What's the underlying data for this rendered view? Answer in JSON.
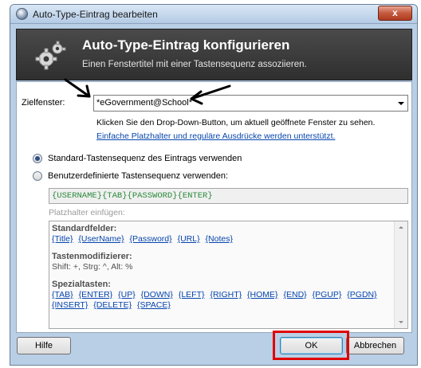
{
  "window": {
    "title": "Auto-Type-Eintrag bearbeiten",
    "close_label": "x"
  },
  "banner": {
    "title": "Auto-Type-Eintrag konfigurieren",
    "subtitle": "Einen Fenstertitel mit einer Tastensequenz assoziieren."
  },
  "target_window": {
    "label": "Zielfenster:",
    "value": "*eGovernment@School*"
  },
  "hint": "Klicken Sie den Drop-Down-Button, um aktuell geöffnete Fenster zu sehen.",
  "placeholder_link": "Einfache Platzhalter und reguläre Ausdrücke werden unterstützt.",
  "options": {
    "default_sequence": "Standard-Tastensequenz des Eintrags verwenden",
    "custom_sequence": "Benutzerdefinierte Tastensequenz verwenden:",
    "selected": "default_sequence"
  },
  "sequence": "{USERNAME}{TAB}{PASSWORD}{ENTER}",
  "placeholders": {
    "label": "Platzhalter einfügen:",
    "sections": [
      {
        "heading": "Standardfelder:",
        "links": [
          "{Title}",
          "{UserName}",
          "{Password}",
          "{URL}",
          "{Notes}"
        ]
      },
      {
        "heading": "Tastenmodifizierer:",
        "text": "Shift: +, Strg: ^, Alt: %"
      },
      {
        "heading": "Spezialtasten:",
        "links": [
          "{TAB}",
          "{ENTER}",
          "{UP}",
          "{DOWN}",
          "{LEFT}",
          "{RIGHT}",
          "{HOME}",
          "{END}",
          "{PGUP}",
          "{PGDN}",
          "{INSERT}",
          "{DELETE}",
          "{SPACE}"
        ]
      }
    ]
  },
  "buttons": {
    "help": "Hilfe",
    "ok": "OK",
    "cancel": "Abbrechen"
  },
  "colors": {
    "annotation_box": "#e00000",
    "sequence_text": "#2a8a3c",
    "link": "#0645ad"
  }
}
